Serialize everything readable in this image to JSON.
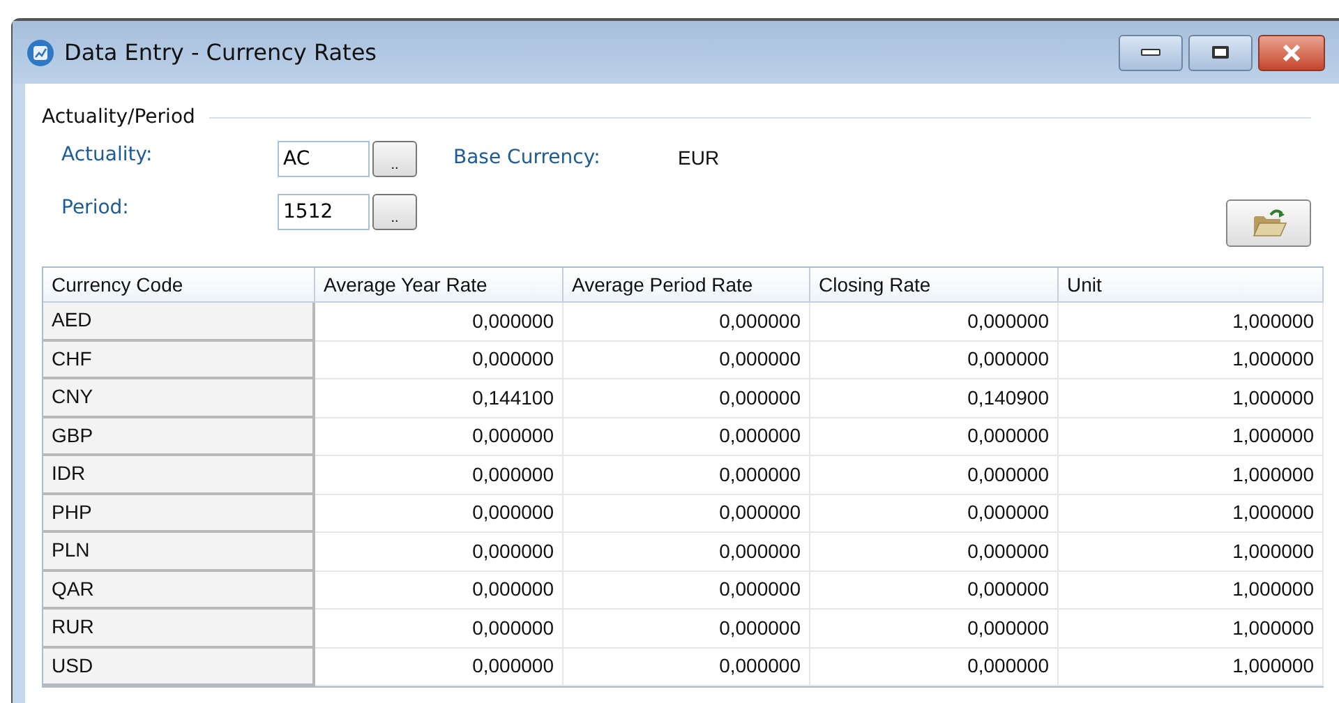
{
  "window": {
    "title": "Data Entry - Currency Rates"
  },
  "group": {
    "title": "Actuality/Period"
  },
  "fields": [
    {
      "label": "Actuality:",
      "value": "AC",
      "button": ".."
    },
    {
      "label": "Period:",
      "value": "1512",
      "button": ".."
    }
  ],
  "base_currency": {
    "label": "Base Currency:",
    "value": "EUR"
  },
  "table": {
    "columns": [
      "Currency Code",
      "Average Year Rate",
      "Average Period Rate",
      "Closing Rate",
      "Unit"
    ],
    "rows": [
      [
        "AED",
        "0,000000",
        "0,000000",
        "0,000000",
        "1,000000"
      ],
      [
        "CHF",
        "0,000000",
        "0,000000",
        "0,000000",
        "1,000000"
      ],
      [
        "CNY",
        "0,144100",
        "0,000000",
        "0,140900",
        "1,000000"
      ],
      [
        "GBP",
        "0,000000",
        "0,000000",
        "0,000000",
        "1,000000"
      ],
      [
        "IDR",
        "0,000000",
        "0,000000",
        "0,000000",
        "1,000000"
      ],
      [
        "PHP",
        "0,000000",
        "0,000000",
        "0,000000",
        "1,000000"
      ],
      [
        "PLN",
        "0,000000",
        "0,000000",
        "0,000000",
        "1,000000"
      ],
      [
        "QAR",
        "0,000000",
        "0,000000",
        "0,000000",
        "1,000000"
      ],
      [
        "RUR",
        "0,000000",
        "0,000000",
        "0,000000",
        "1,000000"
      ],
      [
        "USD",
        "0,000000",
        "0,000000",
        "0,000000",
        "1,000000"
      ]
    ]
  }
}
